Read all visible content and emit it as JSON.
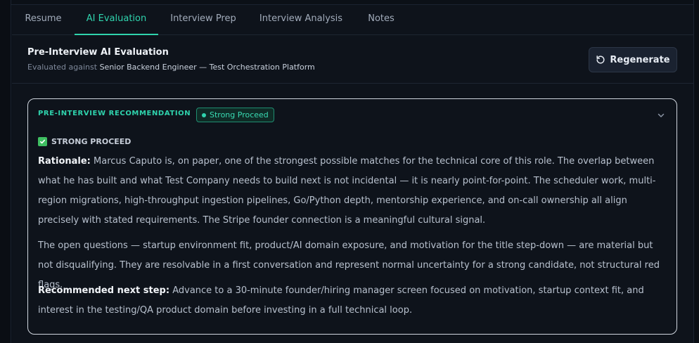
{
  "tabs": [
    "Resume",
    "AI Evaluation",
    "Interview Prep",
    "Interview Analysis",
    "Notes"
  ],
  "active_tab": "AI Evaluation",
  "header": {
    "title": "Pre-Interview AI Evaluation",
    "subtitle_prefix": "Evaluated against",
    "role": "Senior Backend Engineer — Test Orchestration Platform",
    "regenerate_label": "Regenerate"
  },
  "card": {
    "label": "PRE-INTERVIEW RECOMMENDATION",
    "badge": "Strong Proceed",
    "verdict": "STRONG PROCEED",
    "rationale_label": "Rationale:",
    "rationale": "Marcus Caputo is, on paper, one of the strongest possible matches for the technical core of this role. The overlap between what he has built and what Test Company needs to build next is not incidental — it is nearly point-for-point. The scheduler work, multi-region migrations, high-throughput ingestion pipelines, Go/Python depth, mentorship experience, and on-call ownership all align precisely with stated requirements. The Stripe founder connection is a meaningful cultural signal.",
    "open_questions": "The open questions — startup environment fit, product/AI domain exposure, and motivation for the title step-down — are material but not disqualifying. They are resolvable in a first conversation and represent normal uncertainty for a strong candidate, not structural red flags.",
    "next_step_label": "Recommended next step:",
    "next_step": "Advance to a 30-minute founder/hiring manager screen focused on motivation, startup context fit, and interest in the testing/QA product domain before investing in a full technical loop."
  },
  "colors": {
    "accent": "#2fd3ad",
    "background": "#0e131b",
    "verdict_check": "#3fbf62"
  },
  "icons": [
    "refresh-icon",
    "chevron-down-icon",
    "check-box-icon",
    "status-dot-icon"
  ]
}
